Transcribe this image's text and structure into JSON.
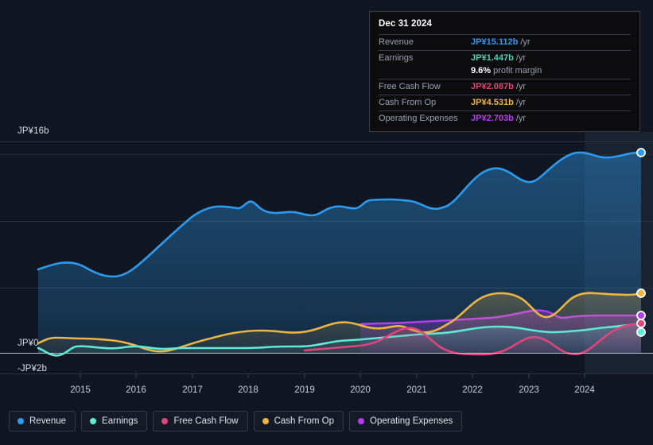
{
  "tooltip": {
    "date": "Dec 31 2024",
    "rows": [
      {
        "name": "Revenue",
        "value": "JP¥15.112b",
        "unit": "/yr",
        "color": "#2d9bf0"
      },
      {
        "name": "Earnings",
        "value": "JP¥1.447b",
        "unit": "/yr",
        "color": "#4fd1b5"
      },
      {
        "name": "",
        "value": "9.6%",
        "unit": "profit margin",
        "color": "#ffffff"
      },
      {
        "name": "Free Cash Flow",
        "value": "JP¥2.087b",
        "unit": "/yr",
        "color": "#e0457b"
      },
      {
        "name": "Cash From Op",
        "value": "JP¥4.531b",
        "unit": "/yr",
        "color": "#eeb544"
      },
      {
        "name": "Operating Expenses",
        "value": "JP¥2.703b",
        "unit": "/yr",
        "color": "#b23ff0"
      }
    ]
  },
  "axes": {
    "y_top_label": "JP¥16b",
    "y_zero_label": "JP¥0",
    "y_neg_label": "-JP¥2b",
    "x_labels": [
      "2015",
      "2016",
      "2017",
      "2018",
      "2019",
      "2020",
      "2021",
      "2022",
      "2023",
      "2024"
    ]
  },
  "legend": [
    {
      "label": "Revenue",
      "color": "#2d9bf0"
    },
    {
      "label": "Earnings",
      "color": "#5eead4"
    },
    {
      "label": "Free Cash Flow",
      "color": "#e0457b"
    },
    {
      "label": "Cash From Op",
      "color": "#eeb544"
    },
    {
      "label": "Operating Expenses",
      "color": "#b23ff0"
    }
  ],
  "chart_data": {
    "type": "area",
    "title": "",
    "xlabel": "",
    "ylabel": "JP¥ (billions)",
    "ylim": [
      -2,
      16
    ],
    "grid": true,
    "legend_position": "bottom",
    "currency": "JP¥",
    "unit": "b",
    "period": "/yr",
    "x_tick_labels": [
      "2015",
      "2016",
      "2017",
      "2018",
      "2019",
      "2020",
      "2021",
      "2022",
      "2023",
      "2024"
    ],
    "x": [
      2014.4,
      2014.8,
      2015.0,
      2015.4,
      2015.8,
      2016.0,
      2016.4,
      2016.8,
      2017.0,
      2017.4,
      2017.8,
      2018.0,
      2018.2,
      2018.5,
      2018.8,
      2019.0,
      2019.3,
      2019.6,
      2020.0,
      2020.3,
      2020.6,
      2021.0,
      2021.3,
      2021.6,
      2022.0,
      2022.3,
      2022.6,
      2023.0,
      2023.3,
      2023.6,
      2024.0,
      2024.4,
      2024.95
    ],
    "series": [
      {
        "name": "Revenue",
        "color": "#2d9bf0",
        "start_year": 2014.4,
        "end_value": 15.112,
        "values": [
          6.3,
          6.7,
          6.6,
          6.3,
          6.1,
          6.2,
          6.6,
          7.3,
          7.7,
          8.6,
          9.5,
          10.2,
          10.3,
          10.9,
          10.3,
          10.2,
          10.1,
          10.3,
          10.5,
          10.5,
          11.0,
          11.1,
          11.1,
          11.0,
          10.8,
          11.7,
          12.6,
          13.0,
          12.8,
          12.3,
          13.6,
          14.6,
          15.112
        ]
      },
      {
        "name": "Earnings",
        "color": "#5eead4",
        "start_year": 2014.4,
        "end_value": 1.447,
        "values": [
          0.05,
          -0.35,
          -0.3,
          0.05,
          0.1,
          0.05,
          0.12,
          0.1,
          0.08,
          0.15,
          0.12,
          0.1,
          0.08,
          0.1,
          0.12,
          0.15,
          0.2,
          0.25,
          0.3,
          0.45,
          0.75,
          0.9,
          0.95,
          0.9,
          0.85,
          0.9,
          1.0,
          1.05,
          0.95,
          0.85,
          0.95,
          1.25,
          1.447
        ]
      },
      {
        "name": "Free Cash Flow",
        "color": "#e0457b",
        "start_year": 2018.8,
        "end_value": 2.087,
        "values": [
          null,
          null,
          null,
          null,
          null,
          null,
          null,
          null,
          null,
          null,
          null,
          null,
          null,
          null,
          0.18,
          0.2,
          0.25,
          0.3,
          0.45,
          1.1,
          1.55,
          1.2,
          0.55,
          0.1,
          -0.1,
          -0.15,
          0.25,
          0.95,
          1.0,
          0.3,
          -0.1,
          1.1,
          2.087
        ]
      },
      {
        "name": "Cash From Op",
        "color": "#eeb544",
        "start_year": 2014.4,
        "end_value": 4.531,
        "values": [
          0.15,
          0.45,
          0.5,
          0.55,
          0.58,
          0.55,
          0.5,
          0.35,
          0.1,
          0.18,
          0.45,
          0.8,
          0.95,
          1.2,
          1.25,
          1.2,
          1.1,
          1.15,
          1.3,
          1.7,
          1.95,
          1.7,
          1.5,
          1.55,
          1.7,
          2.55,
          3.2,
          3.25,
          2.8,
          2.35,
          2.5,
          3.6,
          4.531
        ]
      },
      {
        "name": "Operating Expenses",
        "color": "#b23ff0",
        "start_year": 2019.95,
        "end_value": 2.703,
        "values": [
          null,
          null,
          null,
          null,
          null,
          null,
          null,
          null,
          null,
          null,
          null,
          null,
          null,
          null,
          null,
          null,
          null,
          null,
          1.55,
          1.6,
          1.7,
          1.8,
          1.9,
          1.95,
          2.0,
          2.2,
          2.45,
          2.55,
          2.58,
          2.62,
          2.66,
          2.7,
          2.703
        ]
      }
    ]
  }
}
